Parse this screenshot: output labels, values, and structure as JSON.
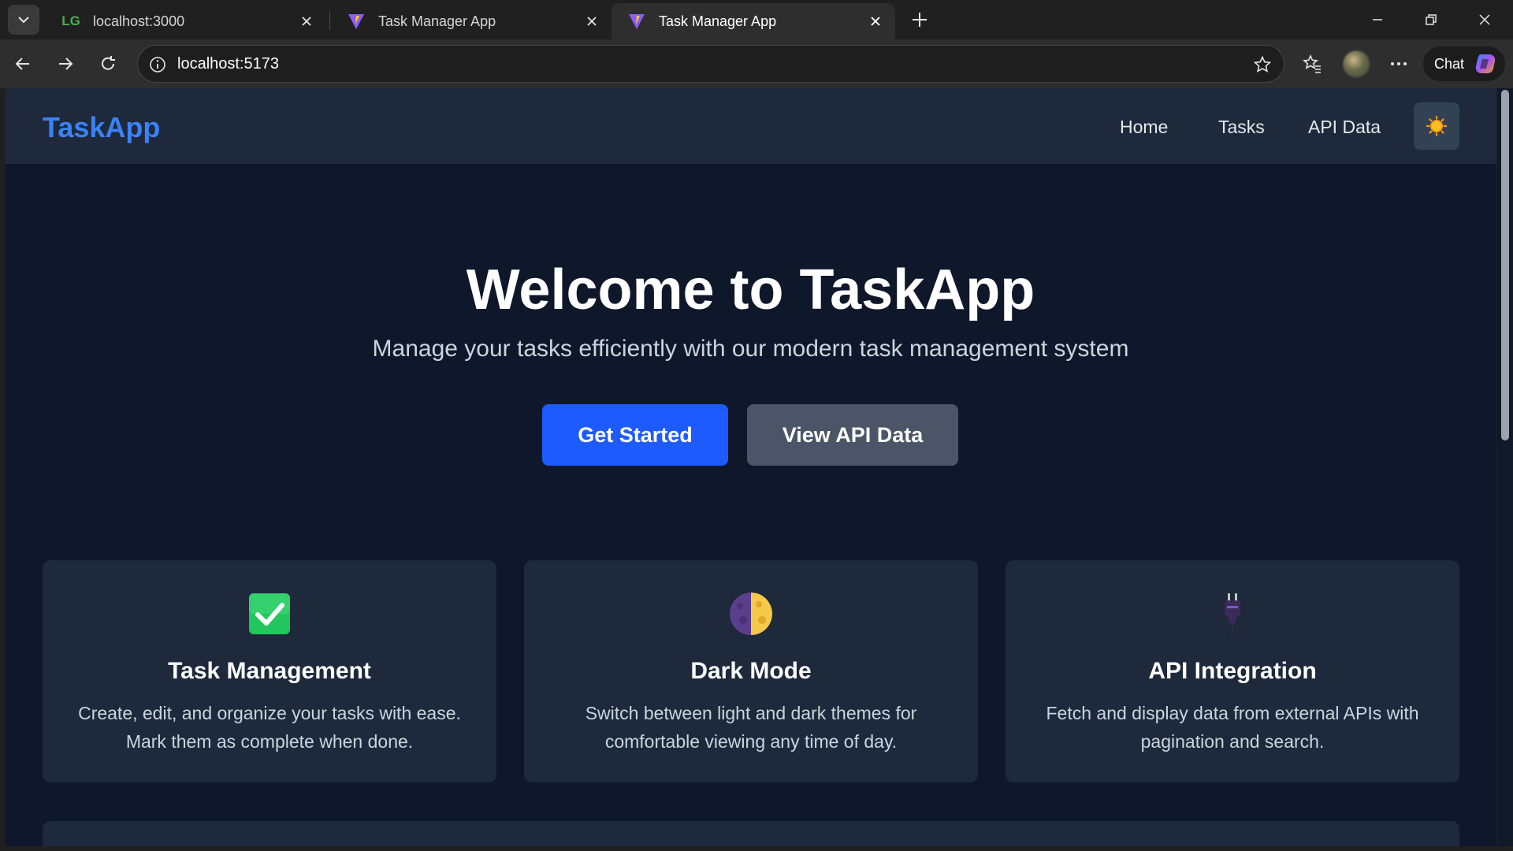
{
  "browser": {
    "tabs": [
      {
        "title": "localhost:3000",
        "favicon": "LG",
        "active": false
      },
      {
        "title": "Task Manager App",
        "favicon": "vite-icon",
        "active": false
      },
      {
        "title": "Task Manager App",
        "favicon": "vite-icon",
        "active": true
      }
    ],
    "address": "localhost:5173",
    "chat_label": "Chat"
  },
  "app": {
    "brand": "TaskApp",
    "nav": {
      "home": "Home",
      "tasks": "Tasks",
      "api": "API Data"
    },
    "theme_icon": "sun-icon",
    "hero": {
      "title": "Welcome to TaskApp",
      "subtitle": "Manage your tasks efficiently with our modern task management system",
      "primary_cta": "Get Started",
      "secondary_cta": "View API Data"
    },
    "features": [
      {
        "icon": "checkmark-icon",
        "title": "Task Management",
        "description": "Create, edit, and organize your tasks with ease. Mark them as complete when done."
      },
      {
        "icon": "moon-icon",
        "title": "Dark Mode",
        "description": "Switch between light and dark themes for comfortable viewing any time of day."
      },
      {
        "icon": "plug-icon",
        "title": "API Integration",
        "description": "Fetch and display data from external APIs with pagination and search."
      }
    ]
  },
  "colors": {
    "brand": "#3b82f6",
    "primary": "#1d5bff",
    "secondary": "#4b5567",
    "background": "#0f172a",
    "surface": "#1e293b"
  }
}
